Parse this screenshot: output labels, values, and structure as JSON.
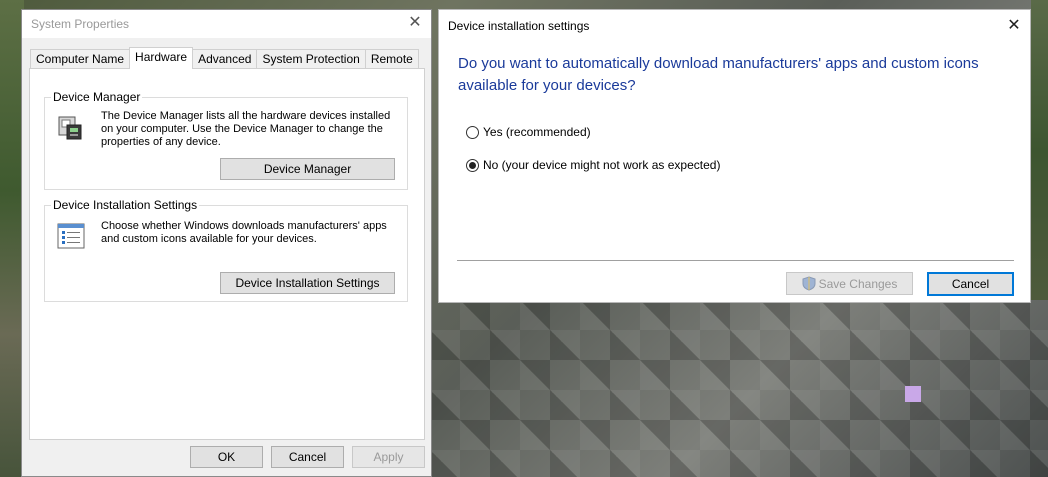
{
  "system_properties": {
    "title": "System Properties",
    "tabs": [
      {
        "label": "Computer Name",
        "active": false
      },
      {
        "label": "Hardware",
        "active": true
      },
      {
        "label": "Advanced",
        "active": false
      },
      {
        "label": "System Protection",
        "active": false
      },
      {
        "label": "Remote",
        "active": false
      }
    ],
    "device_manager": {
      "heading": "Device Manager",
      "description": "The Device Manager lists all the hardware devices installed on your computer. Use the Device Manager to change the properties of any device.",
      "button_label": "Device Manager",
      "icon": "device-manager-icon"
    },
    "device_installation": {
      "heading": "Device Installation Settings",
      "description": "Choose whether Windows downloads manufacturers' apps and custom icons available for your devices.",
      "button_label": "Device Installation Settings",
      "icon": "checklist-icon"
    },
    "footer": {
      "ok_label": "OK",
      "cancel_label": "Cancel",
      "apply_label": "Apply"
    }
  },
  "device_installation_dialog": {
    "title": "Device installation settings",
    "question": "Do you want to automatically download manufacturers' apps and custom icons available for your devices?",
    "options": [
      {
        "label": "Yes (recommended)",
        "selected": false
      },
      {
        "label": "No (your device might not work as expected)",
        "selected": true
      }
    ],
    "save_label": "Save Changes",
    "cancel_label": "Cancel",
    "accent_color": "#1a3a9a"
  }
}
